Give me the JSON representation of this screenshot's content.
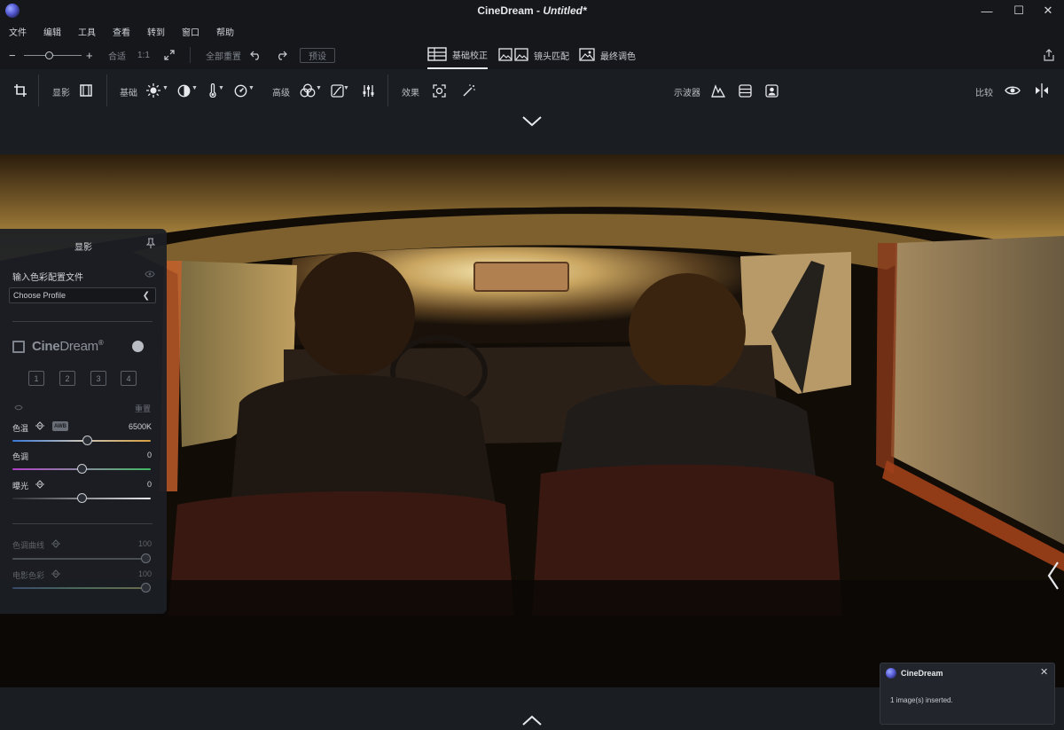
{
  "window": {
    "app_name": "CineDream - ",
    "document": "Untitled*",
    "minimize": "—",
    "maximize": "☐",
    "close": "✕"
  },
  "menu": [
    "文件",
    "编辑",
    "工具",
    "查看",
    "转到",
    "窗口",
    "帮助"
  ],
  "toolbar": {
    "zoom_out": "−",
    "zoom_in": "+",
    "fit": "合适",
    "one_to_one": "1:1",
    "reset_all": "全部重置",
    "preset": "预设",
    "modes": [
      {
        "label": "基础校正",
        "active": true
      },
      {
        "label": "镜头匹配",
        "active": false
      },
      {
        "label": "最终调色",
        "active": false
      }
    ]
  },
  "tools": {
    "develop": "显影",
    "basic": "基础",
    "advanced": "高级",
    "effects": "效果",
    "scopes": "示波器",
    "compare": "比较"
  },
  "panel": {
    "title": "显影",
    "input_profile_label": "输入色彩配置文件",
    "profile_select": "Choose Profile",
    "brand_main": "Cine",
    "brand_light": "Dream",
    "brand_mark": "®",
    "slots": [
      "1",
      "2",
      "3",
      "4"
    ],
    "reset": "重置",
    "sliders": [
      {
        "label": "色温",
        "value": "6500K",
        "awb": "AWB",
        "position": 0.54
      },
      {
        "label": "色调",
        "value": "0",
        "position": 0.5
      },
      {
        "label": "曝光",
        "value": "0",
        "position": 0.5
      },
      {
        "label": "色调曲线",
        "value": "100",
        "position": 1.0
      },
      {
        "label": "电影色彩",
        "value": "100",
        "position": 1.0
      }
    ]
  },
  "notification": {
    "title": "CineDream",
    "message": "1 image(s) inserted.",
    "close": "✕"
  },
  "colors": {
    "background": "#1a1d22",
    "titlebar": "#15171b",
    "panel": "#1c1f24",
    "accent_white": "#e6e8eb"
  }
}
